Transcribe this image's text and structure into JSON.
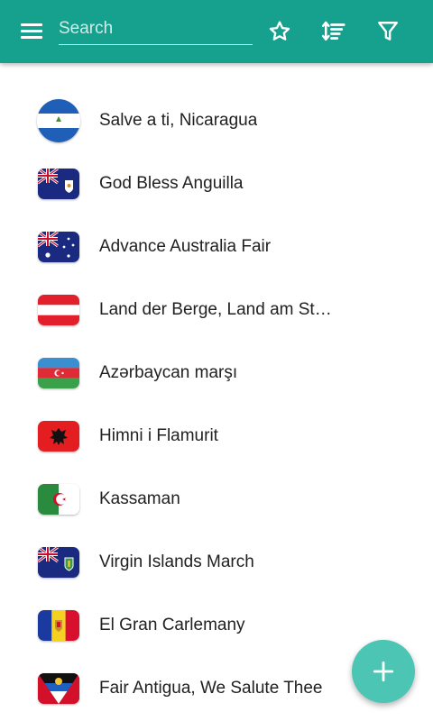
{
  "app_bar": {
    "search_placeholder": "Search",
    "icons": [
      "menu-icon",
      "star-icon",
      "sort-icon",
      "filter-icon"
    ],
    "color": "#16a08e"
  },
  "anthems": [
    {
      "title": "Salve a ti, Nicaragua",
      "flag": "nicaragua-flag"
    },
    {
      "title": "God Bless Anguilla",
      "flag": "anguilla-flag"
    },
    {
      "title": "Advance Australia Fair",
      "flag": "australia-flag"
    },
    {
      "title": "Land der Berge, Land am Strome",
      "flag": "austria-flag"
    },
    {
      "title": "Azərbaycan marşı",
      "flag": "azerbaijan-flag"
    },
    {
      "title": "Himni i Flamurit",
      "flag": "albania-flag"
    },
    {
      "title": "Kassaman",
      "flag": "algeria-flag"
    },
    {
      "title": "Virgin Islands March",
      "flag": "british-virgin-islands-flag"
    },
    {
      "title": "El Gran Carlemany",
      "flag": "andorra-flag"
    },
    {
      "title": "Fair Antigua, We Salute Thee",
      "flag": "antigua-and-barbuda-flag"
    }
  ],
  "fab": {
    "icon": "plus-icon",
    "color": "#4cc5b5"
  }
}
